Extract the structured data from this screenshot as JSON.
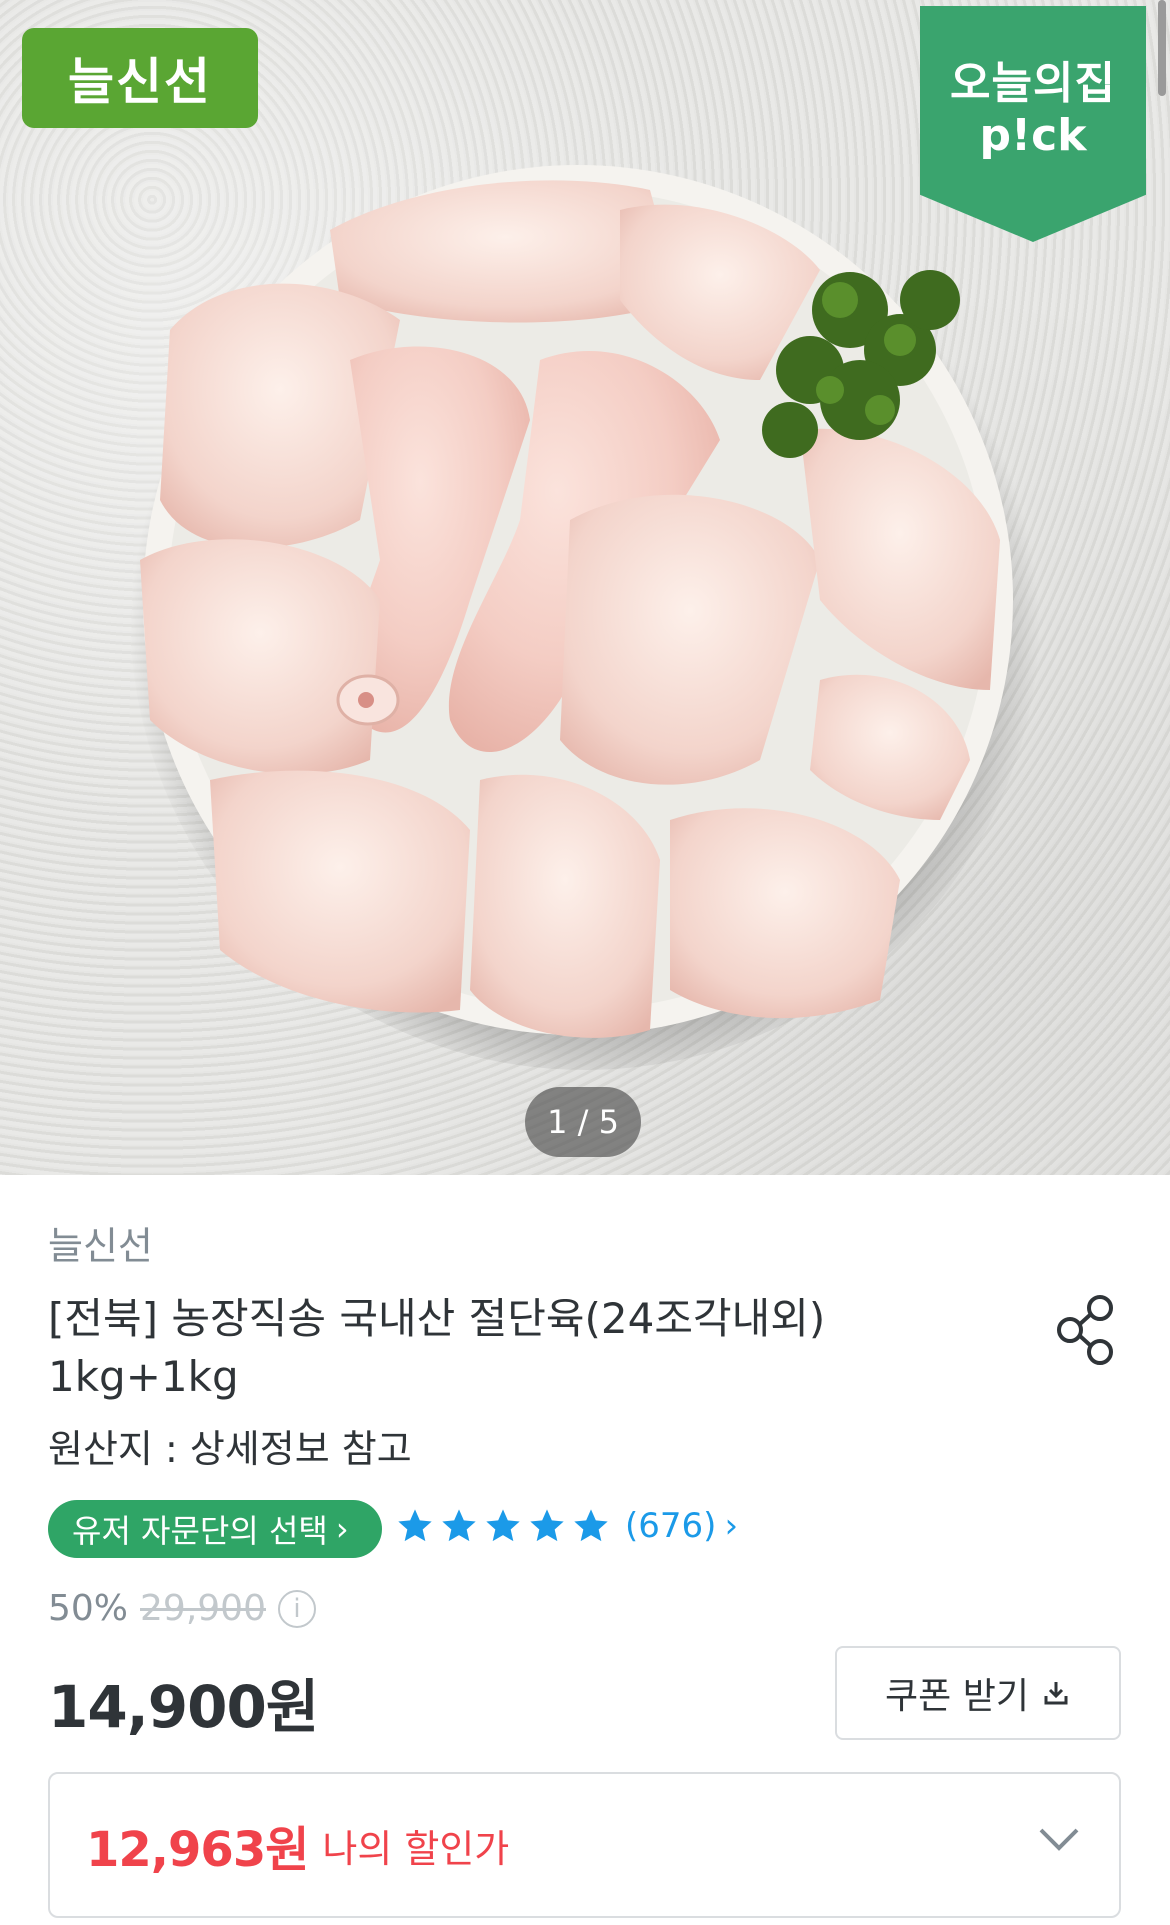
{
  "gallery": {
    "seller_badge": "늘신선",
    "pick_badge_line1": "오늘의집",
    "pick_badge_line2": "p!ck",
    "counter": "1 / 5"
  },
  "product": {
    "brand": "늘신선",
    "title": "[전북] 농장직송 국내산 절단육(24조각내외) 1kg+1kg",
    "origin": "원산지 : 상세정보 참고",
    "advisor_label": "유저 자문단의 선택",
    "rating_stars": 5,
    "review_count": "(676)",
    "discount_rate": "50%",
    "original_price": "29,900",
    "price": "14,900원",
    "coupon_label": "쿠폰 받기",
    "my_price": "12,963원",
    "my_price_label": "나의 할인가"
  },
  "colors": {
    "seller_badge": "#5aa633",
    "pick_badge": "#3aa46e",
    "advisor_chip": "#2fa566",
    "star": "#1b9ae8",
    "my_price": "#f0434b"
  },
  "icons": {
    "share": "share-icon",
    "info": "info-icon",
    "download": "download-icon",
    "chevron": "chevron-down-icon"
  }
}
